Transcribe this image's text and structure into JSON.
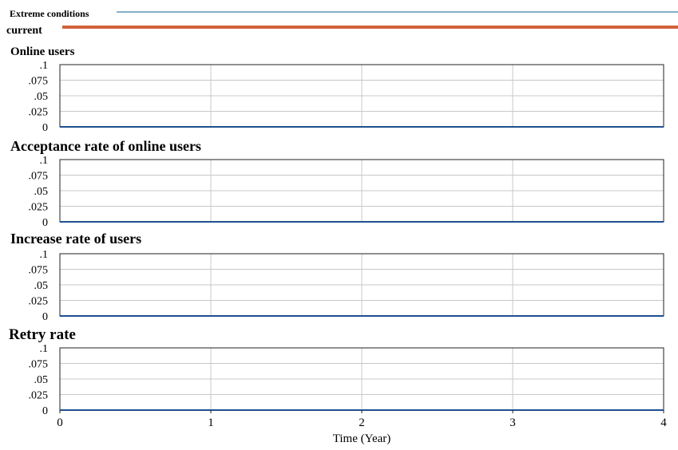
{
  "legend": [
    {
      "label": "Extreme conditions",
      "color": "#3c7fa8"
    },
    {
      "label": "current",
      "color": "#d2623a"
    }
  ],
  "chart_data": [
    {
      "type": "line",
      "title": "Online users",
      "x": [
        0,
        1,
        2,
        3,
        4
      ],
      "ylim": [
        0,
        0.1
      ],
      "yticks": [
        ".1",
        ".075",
        ".05",
        ".025",
        "0"
      ],
      "series": [
        {
          "name": "Extreme conditions",
          "values": [
            0,
            0,
            0,
            0,
            0
          ]
        },
        {
          "name": "current",
          "values": [
            0,
            0,
            0,
            0,
            0
          ]
        }
      ]
    },
    {
      "type": "line",
      "title": "Acceptance rate of online users",
      "x": [
        0,
        1,
        2,
        3,
        4
      ],
      "ylim": [
        0,
        0.1
      ],
      "yticks": [
        ".1",
        ".075",
        ".05",
        ".025",
        "0"
      ],
      "series": [
        {
          "name": "Extreme conditions",
          "values": [
            0,
            0,
            0,
            0,
            0
          ]
        },
        {
          "name": "current",
          "values": [
            0,
            0,
            0,
            0,
            0
          ]
        }
      ]
    },
    {
      "type": "line",
      "title": "Increase rate of users",
      "x": [
        0,
        1,
        2,
        3,
        4
      ],
      "ylim": [
        0,
        0.1
      ],
      "yticks": [
        ".1",
        ".075",
        ".05",
        ".025",
        "0"
      ],
      "series": [
        {
          "name": "Extreme conditions",
          "values": [
            0,
            0,
            0,
            0,
            0
          ]
        },
        {
          "name": "current",
          "values": [
            0,
            0,
            0,
            0,
            0
          ]
        }
      ]
    },
    {
      "type": "line",
      "title": "Retry rate",
      "x": [
        0,
        1,
        2,
        3,
        4
      ],
      "ylim": [
        0,
        0.1
      ],
      "yticks": [
        ".1",
        ".075",
        ".05",
        ".025",
        "0"
      ],
      "xticks": [
        "0",
        "1",
        "2",
        "3",
        "4"
      ],
      "xlabel": "Time (Year)",
      "series": [
        {
          "name": "Extreme conditions",
          "values": [
            0,
            0,
            0,
            0,
            0
          ]
        },
        {
          "name": "current",
          "values": [
            0,
            0,
            0,
            0,
            0
          ]
        }
      ]
    }
  ]
}
